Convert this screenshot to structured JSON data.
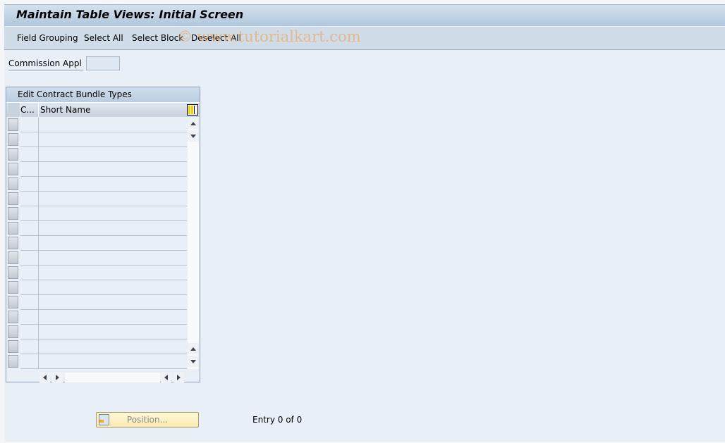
{
  "window": {
    "title": "Maintain Table Views: Initial Screen"
  },
  "toolbar": {
    "items": [
      "Field Grouping",
      "Select All",
      "Select Block",
      "Deselect All"
    ]
  },
  "watermark": "© www.tutorialkart.com",
  "filter": {
    "label": "Commission Appl",
    "value": ""
  },
  "table": {
    "title": "Edit Contract Bundle Types",
    "columns": [
      "C...",
      "Short Name"
    ],
    "rows_visible": 17,
    "rows": []
  },
  "footer": {
    "position_button": "Position...",
    "entry_text": "Entry 0 of 0"
  }
}
